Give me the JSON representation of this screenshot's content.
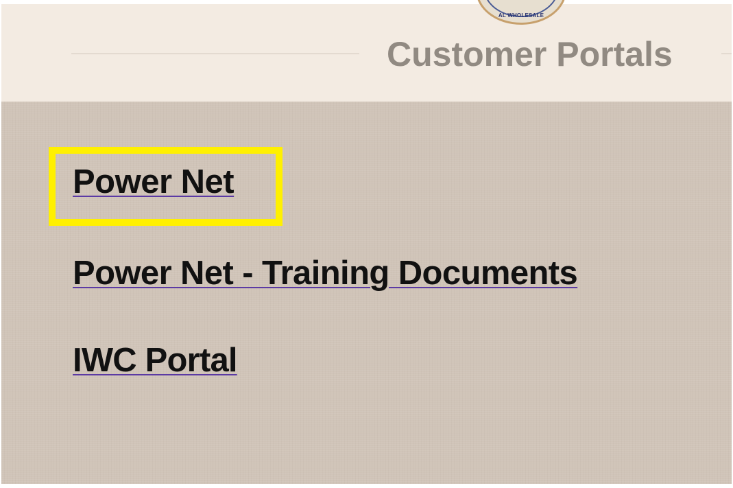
{
  "header": {
    "title": "Customer Portals",
    "logo_text": "AL WHOLESALE"
  },
  "links": [
    {
      "label": "Power Net"
    },
    {
      "label": "Power Net - Training Documents"
    },
    {
      "label": "IWC Portal"
    }
  ],
  "colors": {
    "header_bg": "#f3ebe2",
    "content_bg": "#d0c4b8",
    "title": "#918a82",
    "link_text": "#111111",
    "link_underline": "#5b3aa4",
    "highlight": "#fff000"
  }
}
